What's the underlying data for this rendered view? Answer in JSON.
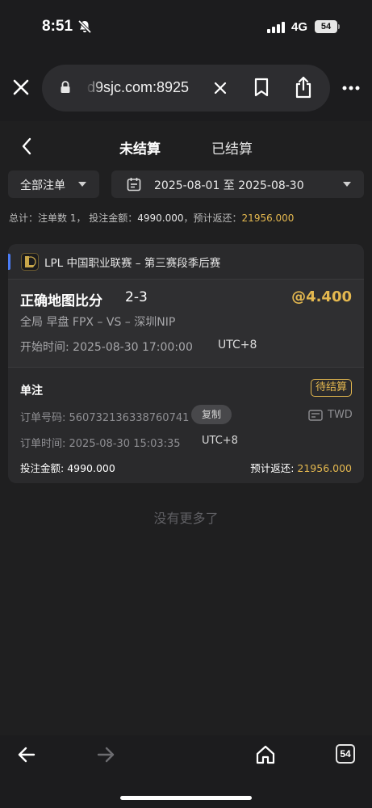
{
  "status_bar": {
    "time": "8:51",
    "network": "4G",
    "battery": "54"
  },
  "browser": {
    "url": "d9sjc.com:8925",
    "tab_count": "54"
  },
  "tabs": {
    "active": "未结算",
    "inactive": "已结算"
  },
  "filters": {
    "type": "全部注单",
    "date_range": "2025-08-01 至 2025-08-30"
  },
  "summary": {
    "prefix": "总计：注单数 1，  投注金额：",
    "stake": "4990.000",
    "mid": "，预计返还：",
    "return": "21956.000"
  },
  "bet": {
    "league": "LPL 中国职业联赛 – 第三赛段季后赛",
    "market": "正确地图比分",
    "selection": "2-3",
    "odds": "@4.400",
    "teams": "全局 早盘  FPX – VS – 深圳NIP",
    "start_time": "开始时间:  2025-08-30 17:00:00",
    "start_tz": "UTC+8",
    "bet_type": "单注",
    "status": "待结算",
    "order_no": "订单号码:  560732136338760741",
    "copy_label": "复制",
    "currency": "TWD",
    "order_time": "订单时间:  2025-08-30 15:03:35",
    "order_tz": "UTC+8",
    "stake_label": "投注金额: ",
    "stake": "4990.000",
    "return_label": "预计返还: ",
    "return": "21956.000"
  },
  "footer_text": "没有更多了",
  "colors": {
    "accent_gold": "#e4b84f",
    "accent_blue": "#4a7cf5",
    "background": "#1f1f20",
    "card": "#2a2a2c"
  },
  "icons": [
    "bell-mute-icon",
    "signal-icon",
    "close-icon",
    "lock-icon",
    "clear-icon",
    "bookmark-icon",
    "share-icon",
    "more-icon",
    "chevron-left-icon",
    "calendar-icon",
    "lol-logo-icon",
    "currency-icon",
    "arrow-left-icon",
    "arrow-right-icon",
    "home-icon"
  ]
}
